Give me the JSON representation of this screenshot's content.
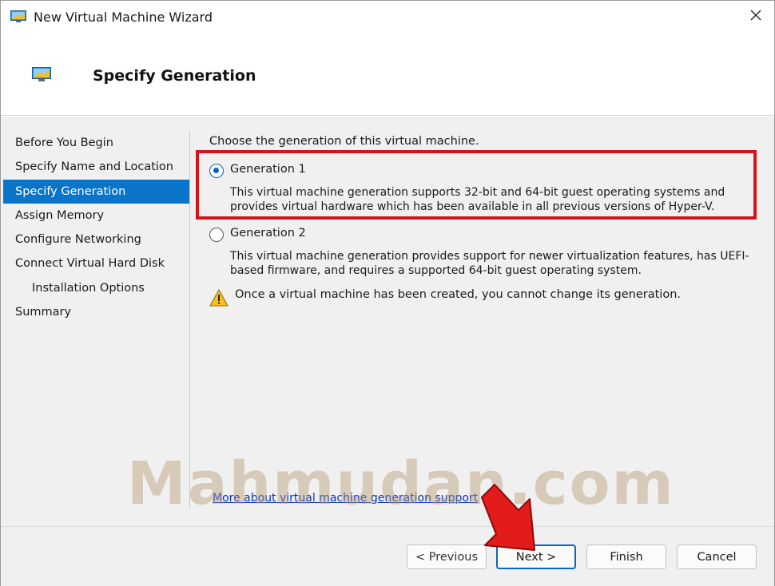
{
  "window": {
    "title": "New Virtual Machine Wizard",
    "icon": "vm-monitor-icon",
    "close_icon": "close-icon"
  },
  "header": {
    "title": "Specify Generation",
    "icon": "vm-monitor-icon"
  },
  "sidebar": {
    "items": [
      {
        "label": "Before You Begin",
        "selected": false,
        "indent": 0
      },
      {
        "label": "Specify Name and Location",
        "selected": false,
        "indent": 0
      },
      {
        "label": "Specify Generation",
        "selected": true,
        "indent": 0
      },
      {
        "label": "Assign Memory",
        "selected": false,
        "indent": 0
      },
      {
        "label": "Configure Networking",
        "selected": false,
        "indent": 0
      },
      {
        "label": "Connect Virtual Hard Disk",
        "selected": false,
        "indent": 0
      },
      {
        "label": "Installation Options",
        "selected": false,
        "indent": 1
      },
      {
        "label": "Summary",
        "selected": false,
        "indent": 0
      }
    ]
  },
  "main": {
    "intro": "Choose the generation of this virtual machine.",
    "options": [
      {
        "label": "Generation 1",
        "checked": true,
        "description": "This virtual machine generation supports 32-bit and 64-bit guest operating systems and provides virtual hardware which has been available in all previous versions of Hyper-V."
      },
      {
        "label": "Generation 2",
        "checked": false,
        "description": "This virtual machine generation provides support for newer virtualization features, has UEFI-based firmware, and requires a supported 64-bit guest operating system."
      }
    ],
    "warning": "Once a virtual machine has been created, you cannot change its generation.",
    "more_link": "More about virtual machine generation support"
  },
  "watermark": "Mahmudan.com",
  "footer": {
    "previous_label": "< Previous",
    "next_label": "Next >",
    "finish_label": "Finish",
    "cancel_label": "Cancel"
  },
  "colors": {
    "accent": "#0a74c8",
    "highlight_box": "#d2141e",
    "arrow": "#e31b1b",
    "link": "#0033cc"
  }
}
